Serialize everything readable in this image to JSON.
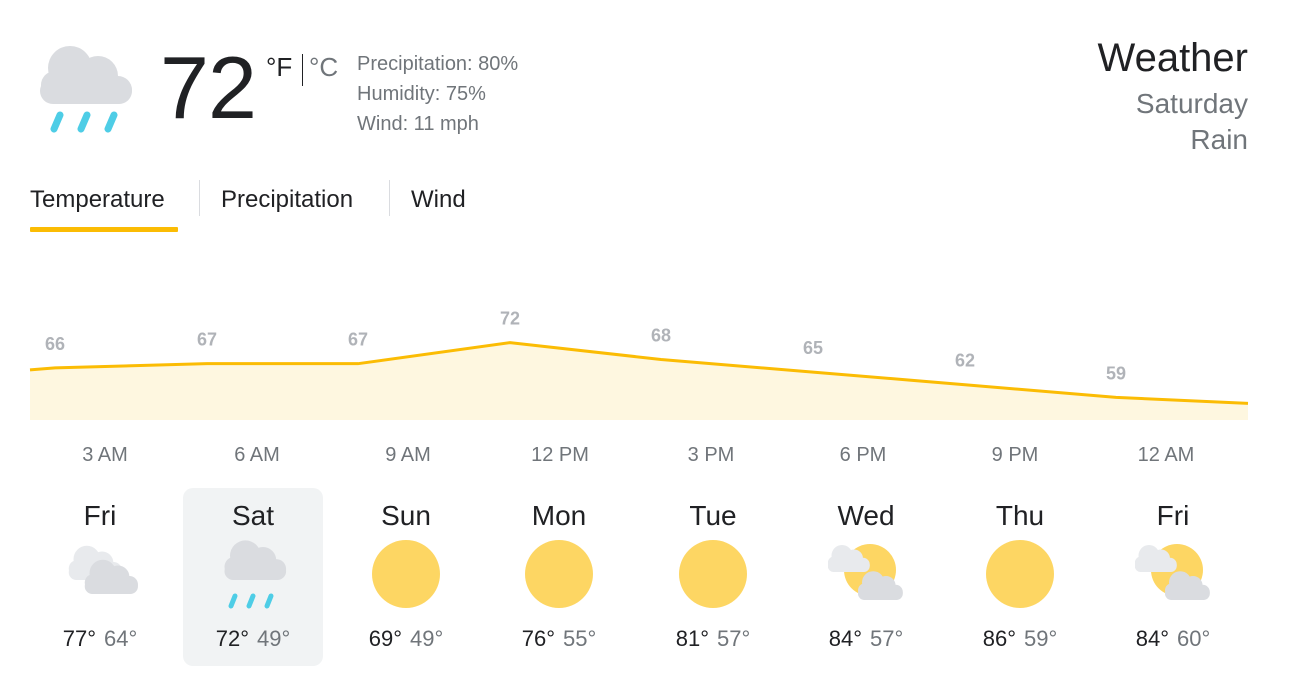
{
  "current": {
    "temperature": "72",
    "unit_f": "°F",
    "unit_c": "°C",
    "precipitation": "Precipitation: 80%",
    "humidity": "Humidity: 75%",
    "wind": "Wind: 11 mph",
    "icon": "rain-cloud-icon"
  },
  "header": {
    "title": "Weather",
    "day": "Saturday",
    "condition": "Rain"
  },
  "tabs": [
    {
      "label": "Temperature",
      "active": true
    },
    {
      "label": "Precipitation",
      "active": false
    },
    {
      "label": "Wind",
      "active": false
    }
  ],
  "colors": {
    "accent": "#fbbc04",
    "chart_fill": "#fef7e0",
    "selected_bg": "#f1f3f4",
    "sun": "#fdd663",
    "cloud": "#dadce0",
    "rain": "#4ecde6"
  },
  "chart_data": {
    "type": "area",
    "x": [
      "3 AM",
      "6 AM",
      "9 AM",
      "12 PM",
      "3 PM",
      "6 PM",
      "9 PM",
      "12 AM"
    ],
    "labels": [
      "66",
      "67",
      "67",
      "72",
      "68",
      "65",
      "62",
      "59"
    ],
    "values": [
      66,
      67,
      67,
      72,
      68,
      65,
      62,
      59
    ]
  },
  "forecast": [
    {
      "day": "Fri",
      "high": "77°",
      "low": "64°",
      "icon": "cloudy-icon",
      "selected": false
    },
    {
      "day": "Sat",
      "high": "72°",
      "low": "49°",
      "icon": "rain-icon",
      "selected": true
    },
    {
      "day": "Sun",
      "high": "69°",
      "low": "49°",
      "icon": "sunny-icon",
      "selected": false
    },
    {
      "day": "Mon",
      "high": "76°",
      "low": "55°",
      "icon": "sunny-icon",
      "selected": false
    },
    {
      "day": "Tue",
      "high": "81°",
      "low": "57°",
      "icon": "sunny-icon",
      "selected": false
    },
    {
      "day": "Wed",
      "high": "84°",
      "low": "57°",
      "icon": "partly-cloudy-icon",
      "selected": false
    },
    {
      "day": "Thu",
      "high": "86°",
      "low": "59°",
      "icon": "sunny-icon",
      "selected": false
    },
    {
      "day": "Fri",
      "high": "84°",
      "low": "60°",
      "icon": "partly-cloudy-icon",
      "selected": false
    }
  ]
}
